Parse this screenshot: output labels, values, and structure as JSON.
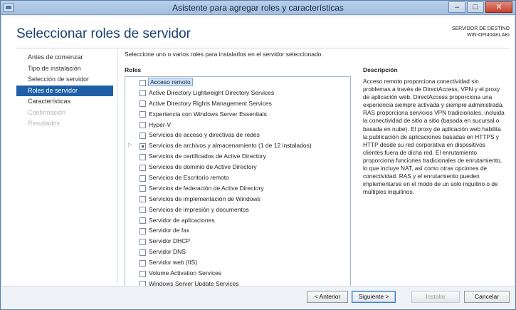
{
  "window": {
    "title": "Asistente para agregar roles y características",
    "controls": [
      "–",
      "□",
      "✕"
    ]
  },
  "header": {
    "page_title": "Seleccionar roles de servidor",
    "dest_label": "SERVIDOR DE DESTINO",
    "dest_server": "WIN-OFI40AKLAKI"
  },
  "nav": {
    "items": [
      {
        "label": "Antes de comenzar",
        "state": "normal"
      },
      {
        "label": "Tipo de instalación",
        "state": "normal"
      },
      {
        "label": "Selección de servidor",
        "state": "normal"
      },
      {
        "label": "Roles de servidor",
        "state": "active"
      },
      {
        "label": "Características",
        "state": "normal"
      },
      {
        "label": "Confirmación",
        "state": "disabled"
      },
      {
        "label": "Resultados",
        "state": "disabled"
      }
    ]
  },
  "main": {
    "instruction": "Seleccione uno o varios roles para instalarlos en el servidor seleccionado.",
    "roles_label": "Roles",
    "roles": [
      {
        "label": "Acceso remoto",
        "checked": false,
        "selected": true
      },
      {
        "label": "Active Directory Lightweight Directory Services",
        "checked": false
      },
      {
        "label": "Active Directory Rights Management Services",
        "checked": false
      },
      {
        "label": "Experiencia con Windows Server Essentials",
        "checked": false
      },
      {
        "label": "Hyper-V",
        "checked": false
      },
      {
        "label": "Servicios de acceso y directivas de redes",
        "checked": false
      },
      {
        "label": "Servicios de archivos y almacenamiento (1 de 12 instalados)",
        "checked": "partial",
        "expandable": true
      },
      {
        "label": "Servicios de certificados de Active Directory",
        "checked": false
      },
      {
        "label": "Servicios de dominio de Active Directory",
        "checked": false
      },
      {
        "label": "Servicios de Escritorio remoto",
        "checked": false
      },
      {
        "label": "Servicios de federación de Active Directory",
        "checked": false
      },
      {
        "label": "Servicios de implementación de Windows",
        "checked": false
      },
      {
        "label": "Servicios de impresión y documentos",
        "checked": false
      },
      {
        "label": "Servidor de aplicaciones",
        "checked": false
      },
      {
        "label": "Servidor de fax",
        "checked": false
      },
      {
        "label": "Servidor DHCP",
        "checked": false
      },
      {
        "label": "Servidor DNS",
        "checked": false
      },
      {
        "label": "Servidor web (IIS)",
        "checked": false
      },
      {
        "label": "Volume Activation Services",
        "checked": false
      },
      {
        "label": "Windows Server Update Services",
        "checked": false
      }
    ],
    "description_label": "Descripción",
    "description": "Acceso remoto proporciona conectividad sin problemas a través de DirectAccess, VPN y el proxy de aplicación web. DirectAccess proporciona una experiencia siempre activada y siempre administrada. RAS proporciona servicios VPN tradicionales, incluida la conectividad de sitio a sitio (basada en sucursal o basada en nube). El proxy de aplicación web habilita la publicación de aplicaciones basadas en HTTPS y HTTP desde su red corporativa en dispositivos clientes fuera de dicha red. El enrutamiento proporciona funciones tradicionales de enrutamiento, lo que incluye NAT, así como otras opciones de conectividad. RAS y el enrutamiento pueden implementarse en el modo de un solo inquilino o de múltiples inquilinos."
  },
  "footer": {
    "back": "< Anterior",
    "next": "Siguiente >",
    "install": "Instalar",
    "cancel": "Cancelar"
  },
  "colors": {
    "accent": "#1f5fa8",
    "title": "#1b3f73",
    "selection": "#cfe4fb"
  }
}
